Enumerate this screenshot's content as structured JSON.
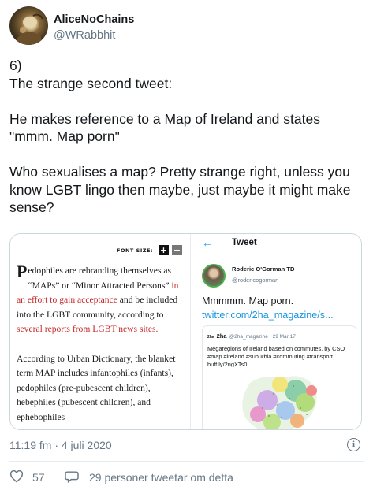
{
  "author": {
    "name": "AliceNoChains",
    "handle": "@WRabbhit",
    "avatar_icon": "alice-avatar-icon"
  },
  "tweet": {
    "text": "6)\nThe strange second tweet:\n\nHe makes reference to a Map of Ireland and states \"mmm. Map porn\"\n\nWho sexualises a map? Pretty strange right, unless you know LGBT lingo then maybe, just maybe it might make sense?"
  },
  "media": {
    "left": {
      "font_size_label": "FONT SIZE:",
      "plus": "+",
      "minus": "−",
      "dropcap": "P",
      "p1_a": "edophiles are rebranding themselves as “MAPs” or “Minor Attracted Persons” ",
      "p1_red1": "in an effort to gain acceptance",
      "p1_b": " and be included into the LGBT community, according to ",
      "p1_red2": "several reports from LGBT news sites.",
      "p2": "According to Urban Dictionary, the blanket term MAP includes infantophiles (infants), pedophiles (pre-pubescent children), hebephiles (pubescent children), and ephebophiles"
    },
    "right": {
      "back_icon": "back-arrow-icon",
      "header_title": "Tweet",
      "name": "Roderic O'Gorman TD",
      "handle": "@rodericogorman",
      "body_plain": "Mmmmm. Map porn. ",
      "body_link": "twitter.com/2ha_magazine/s...",
      "quote": {
        "logo": "2ha",
        "name": "2ha",
        "meta": "@2ha_magazine · 29 Mar 17",
        "text": "Megaregions of Ireland based on commutes, by CSO #map #ireland #suburbia #commuting #transport buff.ly/2ngXTs0"
      }
    }
  },
  "meta": {
    "timestamp": "11:19 fm · 4 juli 2020",
    "info_icon": "info-icon"
  },
  "actions": {
    "like_count": "57",
    "reply_text": "29 personer tweetar om detta"
  },
  "colors": {
    "accent": "#1da1f2",
    "secondary_text": "#657786",
    "article_red": "#c62828"
  }
}
